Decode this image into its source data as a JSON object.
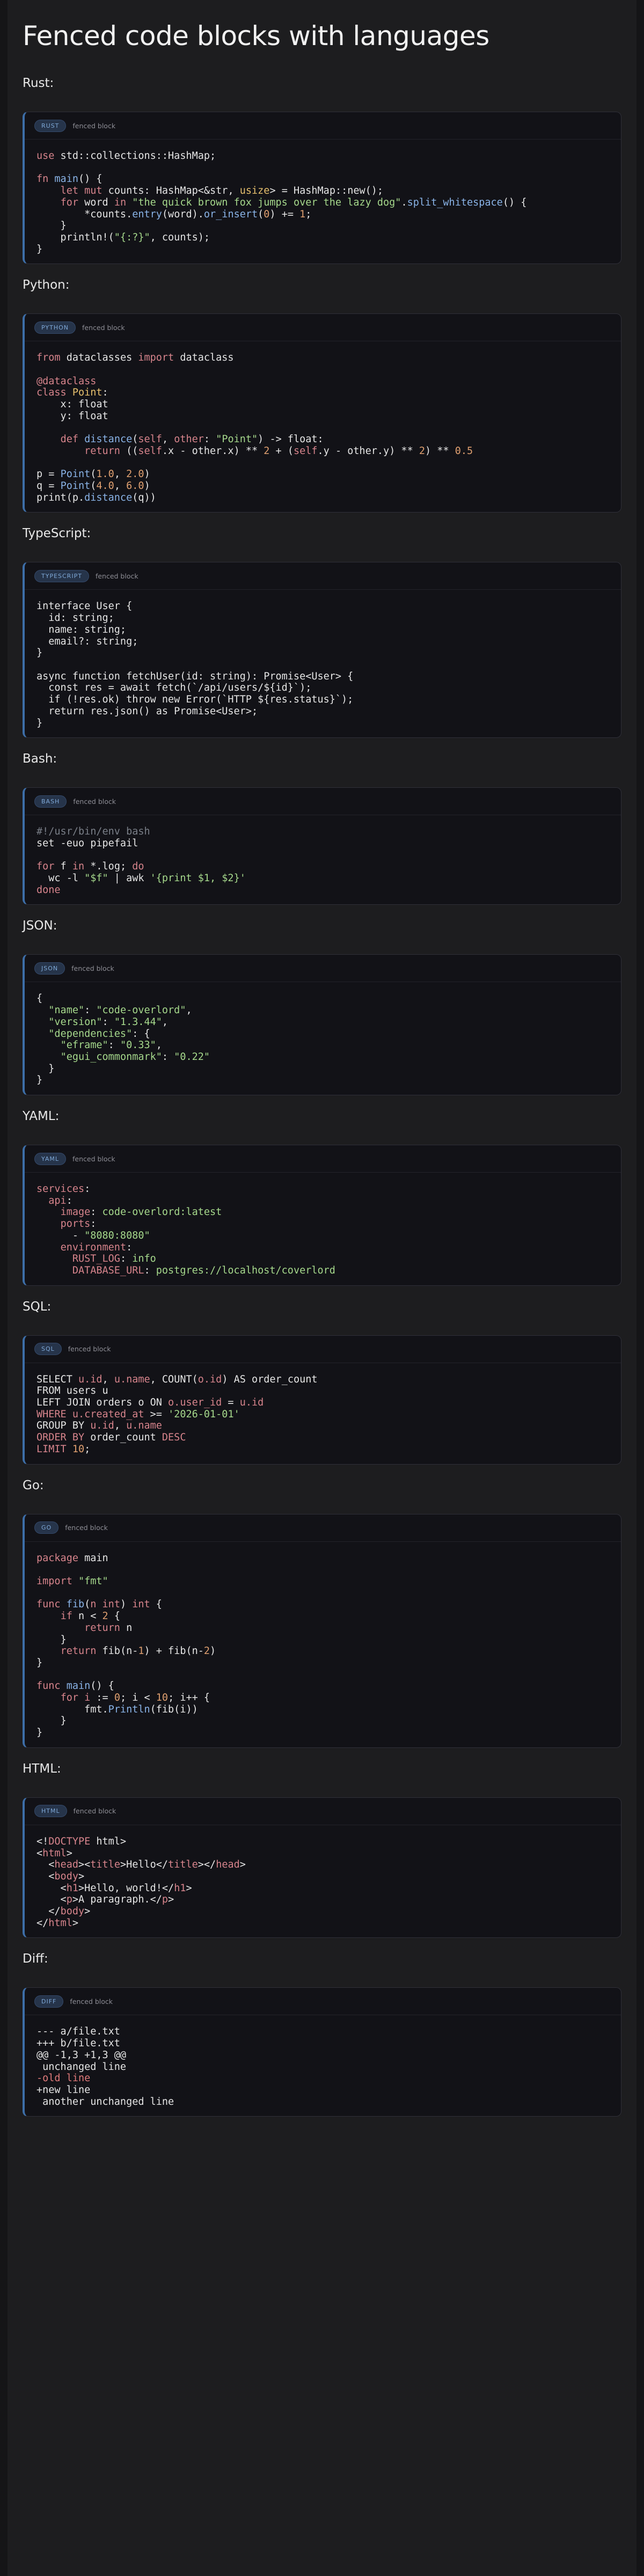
{
  "title": "Fenced code blocks with languages",
  "badge_sub": "fenced block",
  "sections": [
    {
      "label": "Rust:",
      "badge": "RUST"
    },
    {
      "label": "Python:",
      "badge": "PYTHON"
    },
    {
      "label": "TypeScript:",
      "badge": "TYPESCRIPT"
    },
    {
      "label": "Bash:",
      "badge": "BASH"
    },
    {
      "label": "JSON:",
      "badge": "JSON"
    },
    {
      "label": "YAML:",
      "badge": "YAML"
    },
    {
      "label": "SQL:",
      "badge": "SQL"
    },
    {
      "label": "Go:",
      "badge": "GO"
    },
    {
      "label": "HTML:",
      "badge": "HTML"
    },
    {
      "label": "Diff:",
      "badge": "DIFF"
    }
  ],
  "colors": {
    "accent": "#3d6ea8",
    "block_bg": "#121217",
    "page_bg": "#1d1d1f",
    "keyword": "#d7848c",
    "string": "#a6d98c",
    "number": "#e0a070"
  }
}
